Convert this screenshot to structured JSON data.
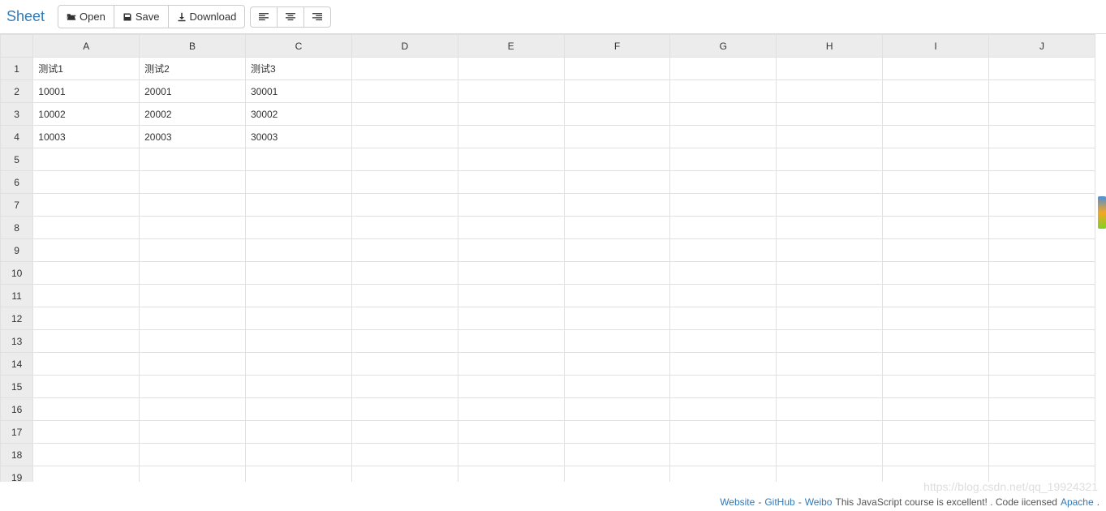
{
  "brand": "Sheet",
  "toolbar": {
    "open_label": "Open",
    "save_label": "Save",
    "download_label": "Download"
  },
  "columns": [
    "A",
    "B",
    "C",
    "D",
    "E",
    "F",
    "G",
    "H",
    "I",
    "J"
  ],
  "row_count": 19,
  "cells": {
    "1": {
      "A": "测试1",
      "B": "测试2",
      "C": "测试3"
    },
    "2": {
      "A": "10001",
      "B": "20001",
      "C": "30001"
    },
    "3": {
      "A": "10002",
      "B": "20002",
      "C": "30002"
    },
    "4": {
      "A": "10003",
      "B": "20003",
      "C": "30003"
    }
  },
  "footer": {
    "website": "Website",
    "github": "GitHub",
    "weibo": "Weibo",
    "text1": "This JavaScript course is excellent! . Code iicensed",
    "apache": "Apache",
    "sep": " - "
  },
  "watermark": "https://blog.csdn.net/qq_19924321"
}
